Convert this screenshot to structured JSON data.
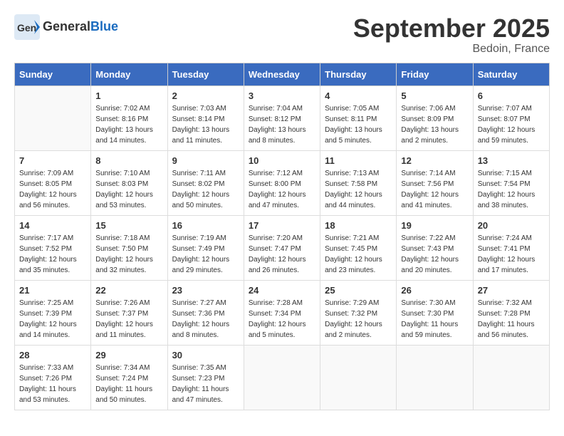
{
  "header": {
    "logo_general": "General",
    "logo_blue": "Blue",
    "month_title": "September 2025",
    "location": "Bedoin, France"
  },
  "calendar": {
    "day_headers": [
      "Sunday",
      "Monday",
      "Tuesday",
      "Wednesday",
      "Thursday",
      "Friday",
      "Saturday"
    ],
    "weeks": [
      [
        {
          "day": "",
          "info": ""
        },
        {
          "day": "1",
          "info": "Sunrise: 7:02 AM\nSunset: 8:16 PM\nDaylight: 13 hours\nand 14 minutes."
        },
        {
          "day": "2",
          "info": "Sunrise: 7:03 AM\nSunset: 8:14 PM\nDaylight: 13 hours\nand 11 minutes."
        },
        {
          "day": "3",
          "info": "Sunrise: 7:04 AM\nSunset: 8:12 PM\nDaylight: 13 hours\nand 8 minutes."
        },
        {
          "day": "4",
          "info": "Sunrise: 7:05 AM\nSunset: 8:11 PM\nDaylight: 13 hours\nand 5 minutes."
        },
        {
          "day": "5",
          "info": "Sunrise: 7:06 AM\nSunset: 8:09 PM\nDaylight: 13 hours\nand 2 minutes."
        },
        {
          "day": "6",
          "info": "Sunrise: 7:07 AM\nSunset: 8:07 PM\nDaylight: 12 hours\nand 59 minutes."
        }
      ],
      [
        {
          "day": "7",
          "info": "Sunrise: 7:09 AM\nSunset: 8:05 PM\nDaylight: 12 hours\nand 56 minutes."
        },
        {
          "day": "8",
          "info": "Sunrise: 7:10 AM\nSunset: 8:03 PM\nDaylight: 12 hours\nand 53 minutes."
        },
        {
          "day": "9",
          "info": "Sunrise: 7:11 AM\nSunset: 8:02 PM\nDaylight: 12 hours\nand 50 minutes."
        },
        {
          "day": "10",
          "info": "Sunrise: 7:12 AM\nSunset: 8:00 PM\nDaylight: 12 hours\nand 47 minutes."
        },
        {
          "day": "11",
          "info": "Sunrise: 7:13 AM\nSunset: 7:58 PM\nDaylight: 12 hours\nand 44 minutes."
        },
        {
          "day": "12",
          "info": "Sunrise: 7:14 AM\nSunset: 7:56 PM\nDaylight: 12 hours\nand 41 minutes."
        },
        {
          "day": "13",
          "info": "Sunrise: 7:15 AM\nSunset: 7:54 PM\nDaylight: 12 hours\nand 38 minutes."
        }
      ],
      [
        {
          "day": "14",
          "info": "Sunrise: 7:17 AM\nSunset: 7:52 PM\nDaylight: 12 hours\nand 35 minutes."
        },
        {
          "day": "15",
          "info": "Sunrise: 7:18 AM\nSunset: 7:50 PM\nDaylight: 12 hours\nand 32 minutes."
        },
        {
          "day": "16",
          "info": "Sunrise: 7:19 AM\nSunset: 7:49 PM\nDaylight: 12 hours\nand 29 minutes."
        },
        {
          "day": "17",
          "info": "Sunrise: 7:20 AM\nSunset: 7:47 PM\nDaylight: 12 hours\nand 26 minutes."
        },
        {
          "day": "18",
          "info": "Sunrise: 7:21 AM\nSunset: 7:45 PM\nDaylight: 12 hours\nand 23 minutes."
        },
        {
          "day": "19",
          "info": "Sunrise: 7:22 AM\nSunset: 7:43 PM\nDaylight: 12 hours\nand 20 minutes."
        },
        {
          "day": "20",
          "info": "Sunrise: 7:24 AM\nSunset: 7:41 PM\nDaylight: 12 hours\nand 17 minutes."
        }
      ],
      [
        {
          "day": "21",
          "info": "Sunrise: 7:25 AM\nSunset: 7:39 PM\nDaylight: 12 hours\nand 14 minutes."
        },
        {
          "day": "22",
          "info": "Sunrise: 7:26 AM\nSunset: 7:37 PM\nDaylight: 12 hours\nand 11 minutes."
        },
        {
          "day": "23",
          "info": "Sunrise: 7:27 AM\nSunset: 7:36 PM\nDaylight: 12 hours\nand 8 minutes."
        },
        {
          "day": "24",
          "info": "Sunrise: 7:28 AM\nSunset: 7:34 PM\nDaylight: 12 hours\nand 5 minutes."
        },
        {
          "day": "25",
          "info": "Sunrise: 7:29 AM\nSunset: 7:32 PM\nDaylight: 12 hours\nand 2 minutes."
        },
        {
          "day": "26",
          "info": "Sunrise: 7:30 AM\nSunset: 7:30 PM\nDaylight: 11 hours\nand 59 minutes."
        },
        {
          "day": "27",
          "info": "Sunrise: 7:32 AM\nSunset: 7:28 PM\nDaylight: 11 hours\nand 56 minutes."
        }
      ],
      [
        {
          "day": "28",
          "info": "Sunrise: 7:33 AM\nSunset: 7:26 PM\nDaylight: 11 hours\nand 53 minutes."
        },
        {
          "day": "29",
          "info": "Sunrise: 7:34 AM\nSunset: 7:24 PM\nDaylight: 11 hours\nand 50 minutes."
        },
        {
          "day": "30",
          "info": "Sunrise: 7:35 AM\nSunset: 7:23 PM\nDaylight: 11 hours\nand 47 minutes."
        },
        {
          "day": "",
          "info": ""
        },
        {
          "day": "",
          "info": ""
        },
        {
          "day": "",
          "info": ""
        },
        {
          "day": "",
          "info": ""
        }
      ]
    ]
  }
}
